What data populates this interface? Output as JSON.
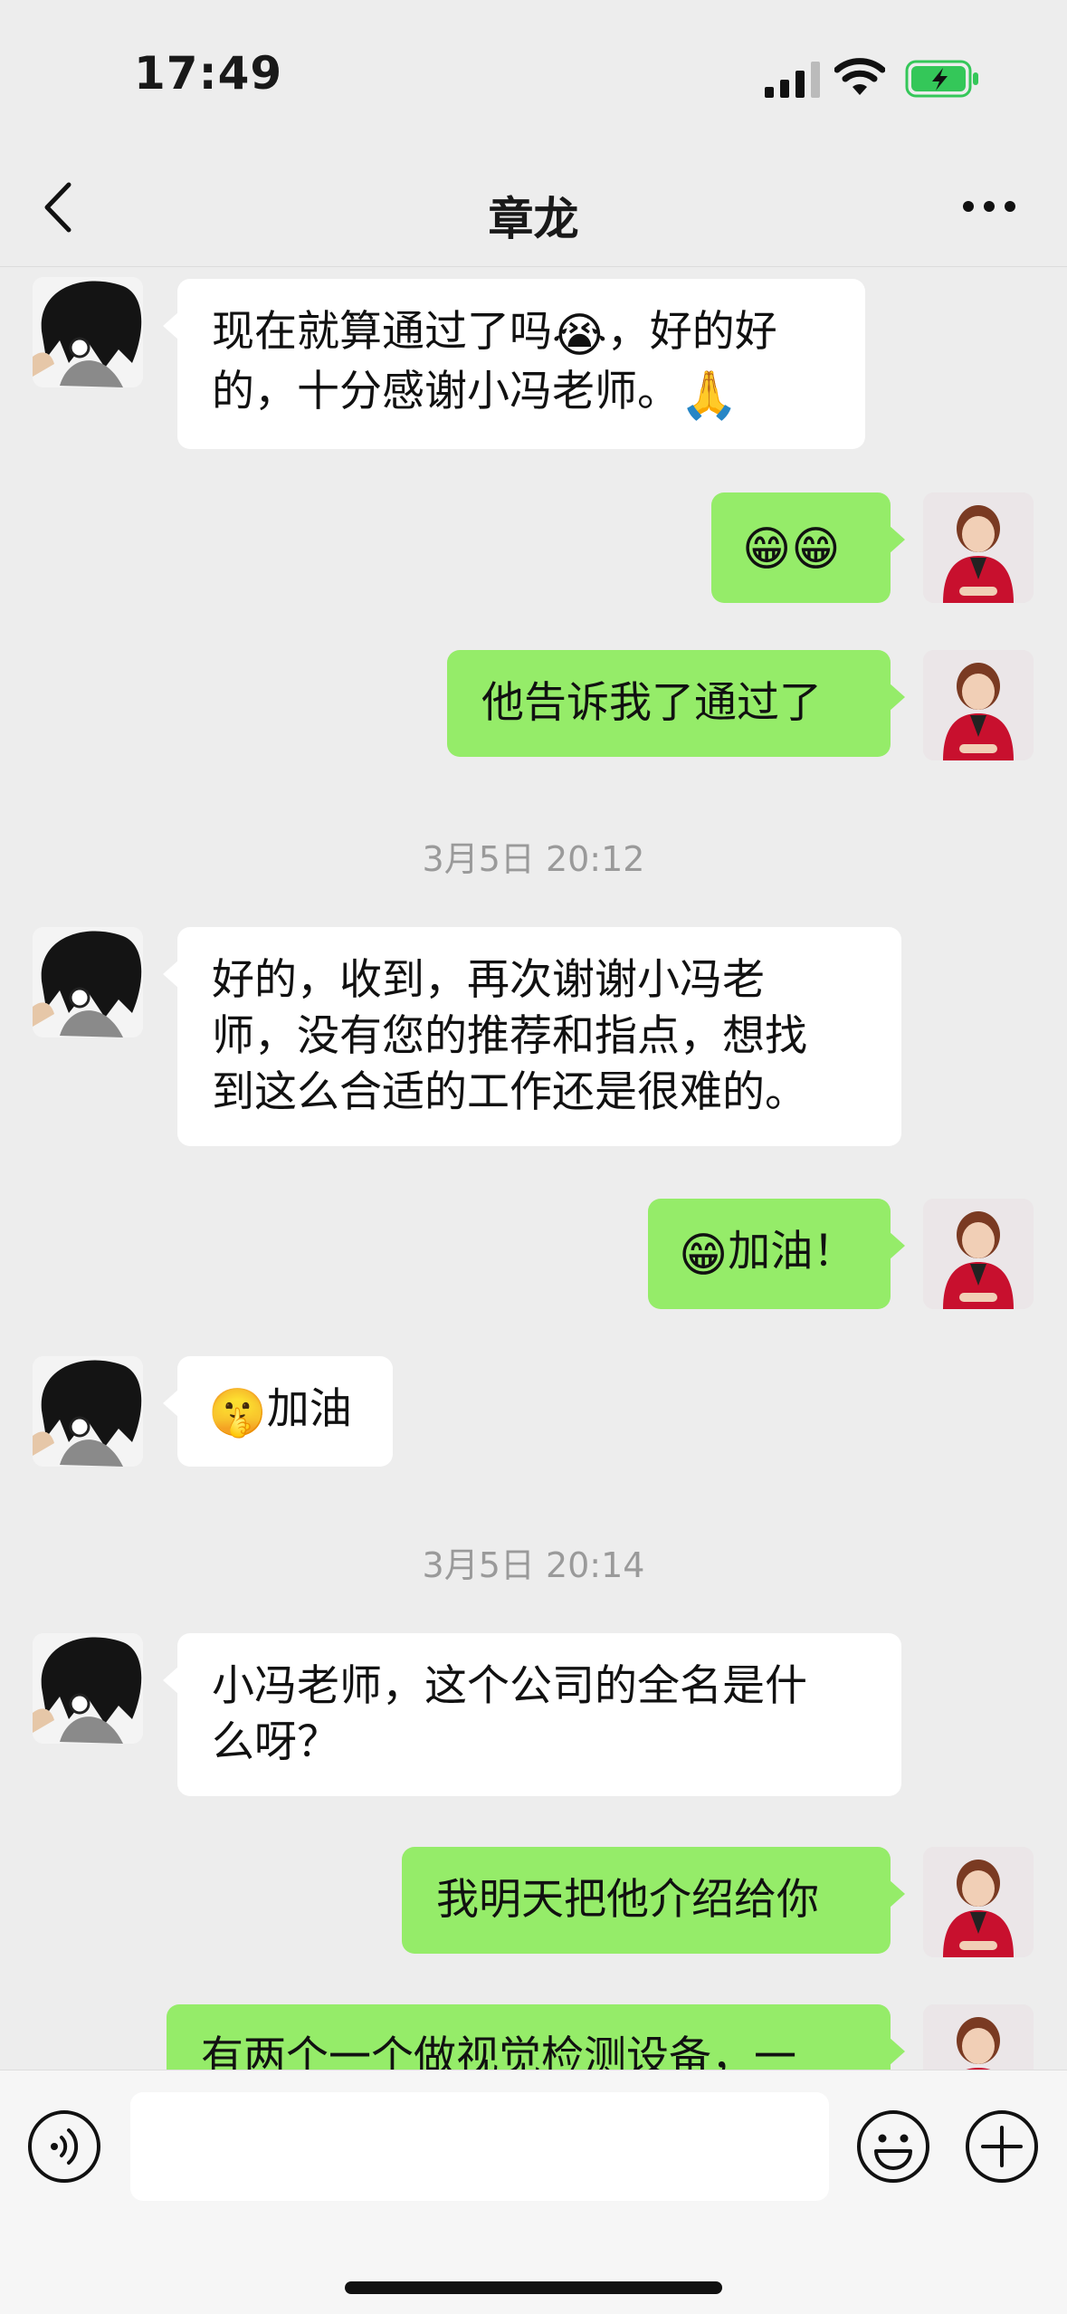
{
  "status_bar": {
    "time": "17:49"
  },
  "header": {
    "title": "章龙"
  },
  "messages": {
    "m1": {
      "line1_a": "现在就算通过了吗",
      "line1_emoji": "😭",
      "line1_b": "，好的好",
      "line2_a": "的，十分感谢小冯老师。",
      "line2_emoji": "🙏"
    },
    "m2": {
      "emoji": "😁😁"
    },
    "m3": {
      "text": "他告诉我了通过了"
    },
    "ts1": "3月5日 20:12",
    "m4": {
      "line1": "好的，收到，再次谢谢小冯老",
      "line2": "师，没有您的推荐和指点，想找",
      "line3": "到这么合适的工作还是很难的。"
    },
    "m5": {
      "emoji": "😁",
      "text": "加油！"
    },
    "m6": {
      "emoji": "🤫",
      "text": "加油"
    },
    "ts2": "3月5日 20:14",
    "m7": {
      "line1": "小冯老师，这个公司的全名是什",
      "line2": "么呀？"
    },
    "m8": {
      "text": "我明天把他介绍给你"
    },
    "m9": {
      "text": "有两个一个做视觉检测设备，一"
    }
  },
  "input_bar": {
    "placeholder": ""
  },
  "colors": {
    "background": "#ededed",
    "bubble_self": "#95ec69",
    "bubble_other": "#ffffff",
    "battery": "#34c759"
  }
}
